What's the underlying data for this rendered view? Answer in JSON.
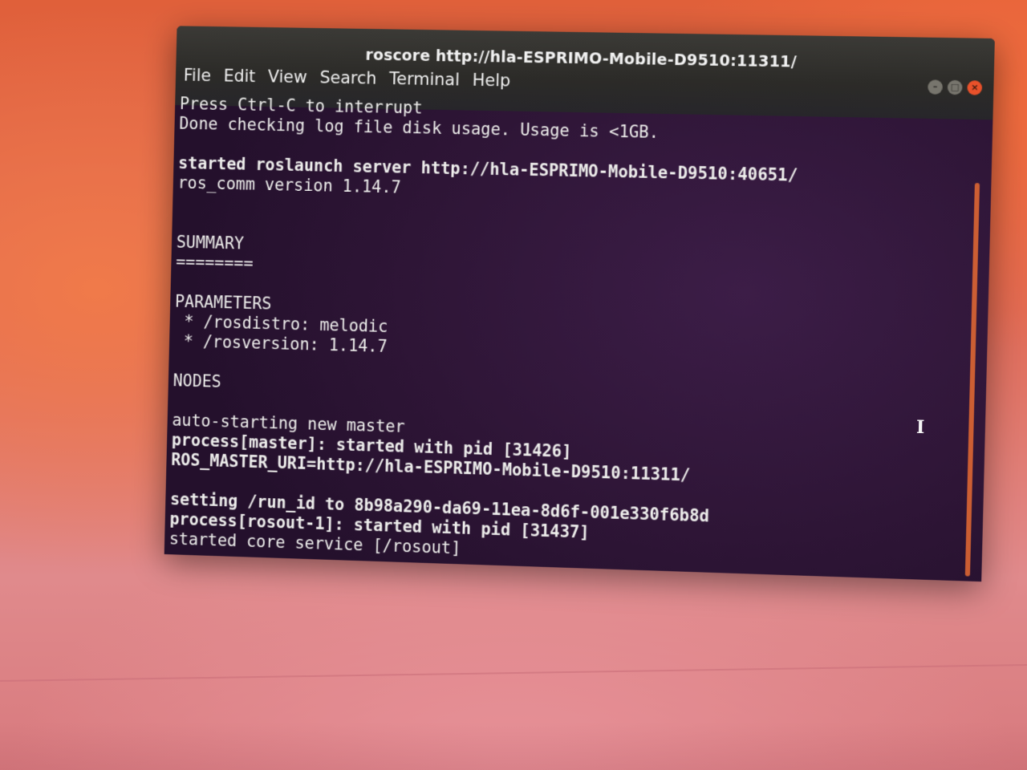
{
  "window": {
    "title": "roscore http://hla-ESPRIMO-Mobile-D9510:11311/",
    "controls": {
      "minimize_icon": "minimize-icon",
      "maximize_icon": "maximize-icon",
      "close_icon": "close-icon"
    }
  },
  "menubar": {
    "items": [
      "File",
      "Edit",
      "View",
      "Search",
      "Terminal",
      "Help"
    ]
  },
  "terminal": {
    "lines": [
      {
        "text": "Press Ctrl-C to interrupt",
        "bold": false
      },
      {
        "text": "Done checking log file disk usage. Usage is <1GB.",
        "bold": false
      },
      {
        "text": "",
        "bold": false
      },
      {
        "text": "started roslaunch server http://hla-ESPRIMO-Mobile-D9510:40651/",
        "bold": true
      },
      {
        "text": "ros_comm version 1.14.7",
        "bold": false
      },
      {
        "text": "",
        "bold": false
      },
      {
        "text": "",
        "bold": false
      },
      {
        "text": "SUMMARY",
        "bold": false
      },
      {
        "text": "========",
        "bold": false
      },
      {
        "text": "",
        "bold": false
      },
      {
        "text": "PARAMETERS",
        "bold": false
      },
      {
        "text": " * /rosdistro: melodic",
        "bold": false
      },
      {
        "text": " * /rosversion: 1.14.7",
        "bold": false
      },
      {
        "text": "",
        "bold": false
      },
      {
        "text": "NODES",
        "bold": false
      },
      {
        "text": "",
        "bold": false
      },
      {
        "text": "auto-starting new master",
        "bold": false
      },
      {
        "text": "process[master]: started with pid [31426]",
        "bold": true
      },
      {
        "text": "ROS_MASTER_URI=http://hla-ESPRIMO-Mobile-D9510:11311/",
        "bold": true
      },
      {
        "text": "",
        "bold": false
      },
      {
        "text": "setting /run_id to 8b98a290-da69-11ea-8d6f-001e330f6b8d",
        "bold": true
      },
      {
        "text": "process[rosout-1]: started with pid [31437]",
        "bold": true
      },
      {
        "text": "started core service [/rosout]",
        "bold": false
      }
    ]
  },
  "colors": {
    "terminal_bg": "#2e1536",
    "titlebar_bg": "#2c2b28",
    "close_button": "#e9512a",
    "scrollbar": "#e86b32",
    "desktop": "#e0603a"
  },
  "cursor_icon": "text-cursor-icon"
}
